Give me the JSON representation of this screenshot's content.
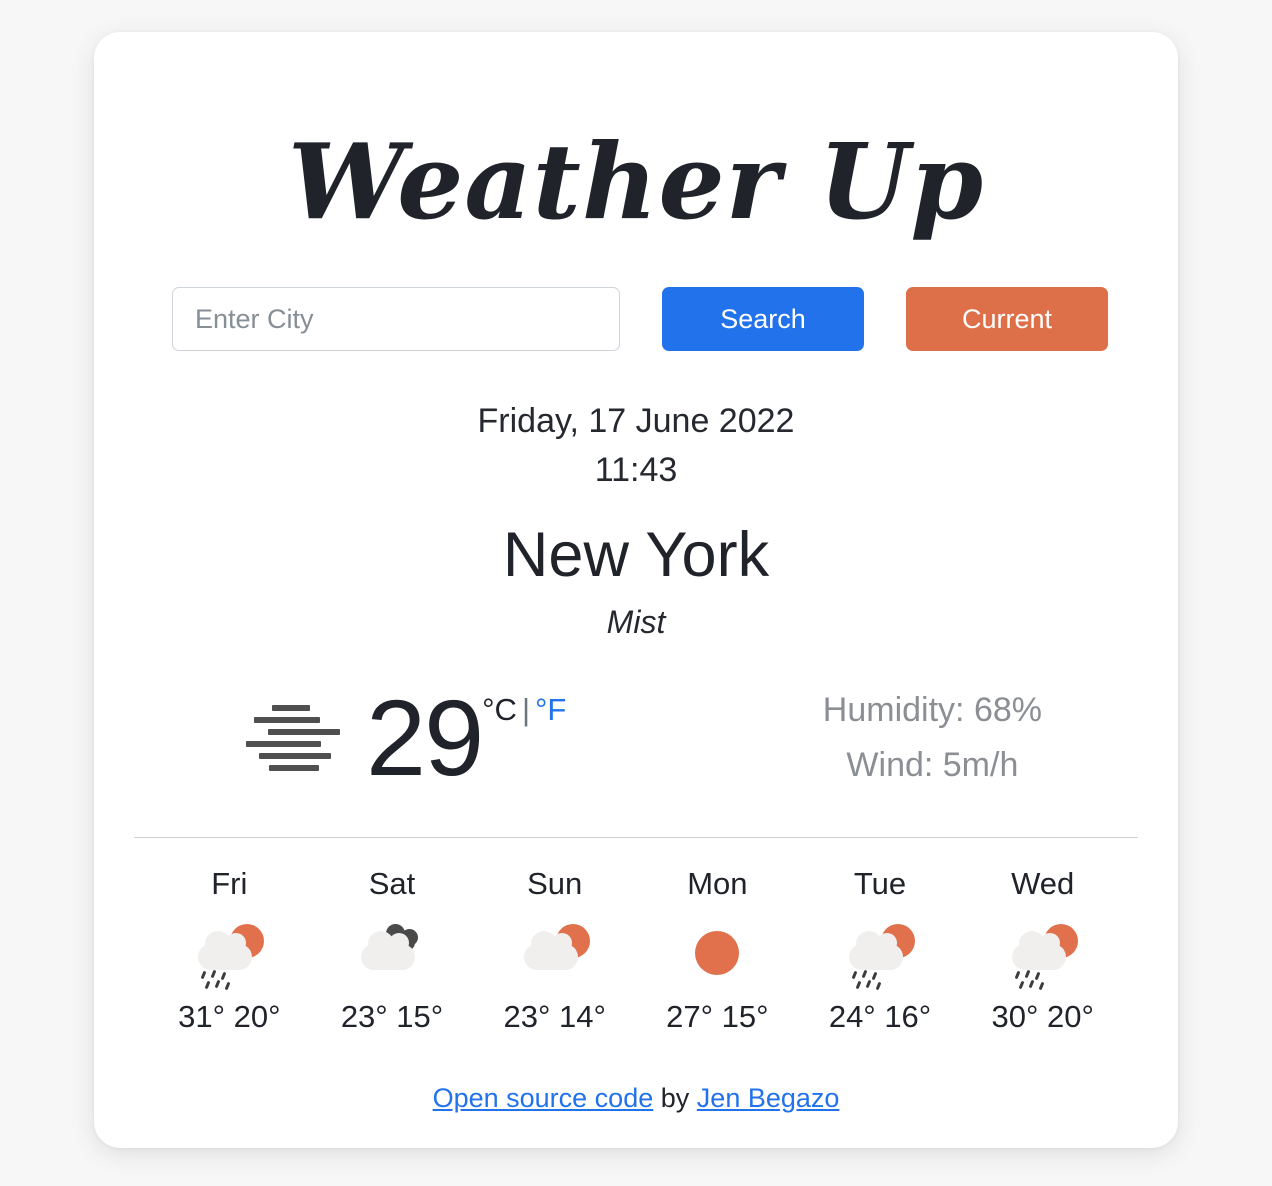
{
  "app": {
    "title": "Weather Up"
  },
  "search": {
    "placeholder": "Enter City",
    "value": "",
    "search_label": "Search",
    "current_label": "Current",
    "search_color": "#2272eb",
    "current_color": "#dd7049"
  },
  "current": {
    "date": "Friday, 17 June 2022",
    "time": "11:43",
    "city": "New York",
    "condition": "Mist",
    "icon": "mist-icon",
    "temperature": "29",
    "unit_celsius": "°C",
    "unit_separator": "|",
    "unit_fahrenheit": "°F",
    "active_unit": "celsius",
    "fahrenheit_color": "#2272eb",
    "humidity": "Humidity: 68%",
    "wind": "Wind: 5m/h"
  },
  "forecast": [
    {
      "day": "Fri",
      "icon": "sun-cloud-rain-icon",
      "temps": "31° 20°",
      "high": "31°",
      "low": "20°"
    },
    {
      "day": "Sat",
      "icon": "clouds-dark-icon",
      "temps": "23° 15°",
      "high": "23°",
      "low": "15°"
    },
    {
      "day": "Sun",
      "icon": "sun-cloud-icon",
      "temps": "23° 14°",
      "high": "23°",
      "low": "14°"
    },
    {
      "day": "Mon",
      "icon": "sun-icon",
      "temps": "27° 15°",
      "high": "27°",
      "low": "15°"
    },
    {
      "day": "Tue",
      "icon": "sun-cloud-rain-icon",
      "temps": "24° 16°",
      "high": "24°",
      "low": "16°"
    },
    {
      "day": "Wed",
      "icon": "sun-cloud-rain-icon",
      "temps": "30° 20°",
      "high": "30°",
      "low": "20°"
    }
  ],
  "footer": {
    "source_link": "Open source code",
    "by_text": "by",
    "author_link": "Jen Begazo",
    "link_color": "#2272eb"
  }
}
